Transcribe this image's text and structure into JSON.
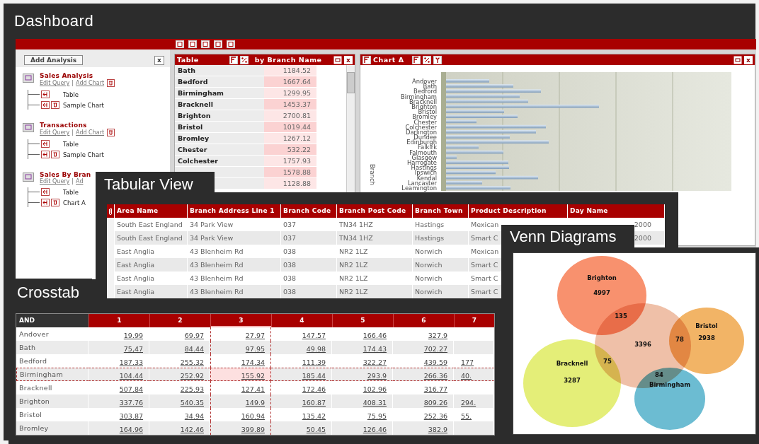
{
  "page_title": "Dashboard",
  "analysis_panel": {
    "add_button": "Add Analysis",
    "close": "x",
    "separator": "|",
    "analyses": [
      {
        "title": "Sales Analysis",
        "links": [
          "Edit Query",
          "Add Chart"
        ],
        "delete_icon": true,
        "children": [
          {
            "label": "Table",
            "kind": "table"
          },
          {
            "label": "Sample Chart",
            "kind": "chart"
          }
        ]
      },
      {
        "title": "Transactions",
        "links": [
          "Edit Query",
          "Add Chart"
        ],
        "delete_icon": true,
        "children": [
          {
            "label": "Table",
            "kind": "table"
          },
          {
            "label": "Sample Chart",
            "kind": "chart"
          }
        ]
      },
      {
        "title": "Sales By Bran",
        "links": [
          "Edit Query",
          "Ad"
        ],
        "delete_icon": false,
        "children": [
          {
            "label": "Table",
            "kind": "table"
          },
          {
            "label": "Chart A",
            "kind": "chart"
          }
        ]
      }
    ]
  },
  "table_panel": {
    "title": "Table",
    "subtitle": "by Branch Name",
    "close": "x",
    "rows": [
      {
        "name": "Bath",
        "value": "1184.52"
      },
      {
        "name": "Bedford",
        "value": "1667.64"
      },
      {
        "name": "Birmingham",
        "value": "1299.95"
      },
      {
        "name": "Bracknell",
        "value": "1453.37"
      },
      {
        "name": "Brighton",
        "value": "2700.81"
      },
      {
        "name": "Bristol",
        "value": "1019.44"
      },
      {
        "name": "Bromley",
        "value": "1267.12"
      },
      {
        "name": "Chester",
        "value": "532.22"
      },
      {
        "name": "Colchester",
        "value": "1757.93"
      },
      {
        "value": "1578.88"
      },
      {
        "value": "1128.88"
      }
    ]
  },
  "chart_panel": {
    "title": "Chart A",
    "close": "x",
    "axis_label": "Branch",
    "categories": [
      "Andover",
      "Bath",
      "Bedford",
      "Birmingham",
      "Bracknell",
      "Brighton",
      "Bristol",
      "Bromley",
      "Chester",
      "Colchester",
      "Darlington",
      "Dundee",
      "Edinburgh",
      "Falkirk",
      "Falmouth",
      "Glasgow",
      "Harrogate",
      "Hastings",
      "Ipswich",
      "Kendal",
      "Lancaster",
      "Leamington"
    ]
  },
  "tabular_view": {
    "title": "Tabular View",
    "columns": [
      "Area Name",
      "Branch Address Line 1",
      "Branch Code",
      "Branch Post Code",
      "Branch Town",
      "Product Description",
      "Day Name"
    ],
    "rows": [
      {
        "cells": [
          "South East England",
          "34 Park View",
          "037",
          "TN34 1HZ",
          "Hastings",
          "Mexican",
          "2000"
        ]
      },
      {
        "cells": [
          "South East England",
          "34 Park View",
          "037",
          "TN34 1HZ",
          "Hastings",
          "Smart C",
          "2000"
        ]
      },
      {
        "cells": [
          "East Anglia",
          "43 Blenheim Rd",
          "038",
          "NR2 1LZ",
          "Norwich",
          "Mexican"
        ]
      },
      {
        "cells": [
          "East Anglia",
          "43 Blenheim Rd",
          "038",
          "NR2 1LZ",
          "Norwich",
          "Smart C"
        ]
      },
      {
        "cells": [
          "East Anglia",
          "43 Blenheim Rd",
          "038",
          "NR2 1LZ",
          "Norwich",
          "Smart C"
        ]
      },
      {
        "cells": [
          "East Anglia",
          "43 Blenheim Rd",
          "038",
          "NR2 1LZ",
          "Norwich",
          "Smart C"
        ]
      }
    ]
  },
  "crosstab": {
    "title": "Crosstab",
    "corner": "AND",
    "columns": [
      {
        "label": "1",
        "selected": false
      },
      {
        "label": "2",
        "selected": false
      },
      {
        "label": "3",
        "selected": true
      },
      {
        "label": "4",
        "selected": false
      },
      {
        "label": "5",
        "selected": false
      },
      {
        "label": "6",
        "selected": false
      },
      {
        "label": "7",
        "selected": false
      }
    ],
    "rows": [
      {
        "name": "Andover",
        "selected": false,
        "values": [
          "19.99",
          "69.97",
          "27.97",
          "147.57",
          "166.46",
          "327.9"
        ]
      },
      {
        "name": "Bath",
        "selected": false,
        "values": [
          "75,47",
          "84.44",
          "97.95",
          "49.98",
          "174.43",
          "702.27"
        ]
      },
      {
        "name": "Bedford",
        "selected": false,
        "values": [
          "187.33",
          "255.32",
          "174.34",
          "111.39",
          "322.27",
          "439.59",
          "177"
        ]
      },
      {
        "name": "Birmingham",
        "selected": true,
        "values": [
          "104.44",
          "252.92",
          "155.92",
          "185.44",
          "293.9",
          "266.36",
          "40."
        ]
      },
      {
        "name": "Bracknell",
        "selected": false,
        "values": [
          "507.84",
          "225.93",
          "127.41",
          "172.46",
          "102.96",
          "316.77"
        ]
      },
      {
        "name": "Brighton",
        "selected": false,
        "values": [
          "337.76",
          "540.35",
          "149.9",
          "160.87",
          "408.31",
          "809.26",
          "294."
        ]
      },
      {
        "name": "Bristol",
        "selected": false,
        "values": [
          "303.87",
          "34.94",
          "160.94",
          "135.42",
          "75.95",
          "252.36",
          "55."
        ]
      },
      {
        "name": "Bromley",
        "selected": false,
        "values": [
          "164.96",
          "142.46",
          "399.89",
          "50.45",
          "126.46",
          "382.9"
        ]
      }
    ]
  },
  "venn": {
    "title": "Venn Diagrams",
    "sets": [
      {
        "name": "Bracknell",
        "value": "3287",
        "color": "#e4ee78"
      },
      {
        "name": "Birmingham",
        "color": "#6cbcd2"
      },
      {
        "value": "3396",
        "color": "#efc0a8"
      },
      {
        "name": "Brighton",
        "value": "4997",
        "color": "#f8916e"
      },
      {
        "name": "Bristol",
        "value": "2938",
        "color": "#f2b466"
      }
    ],
    "intersections": [
      "135",
      "78",
      "75",
      "84"
    ]
  }
}
